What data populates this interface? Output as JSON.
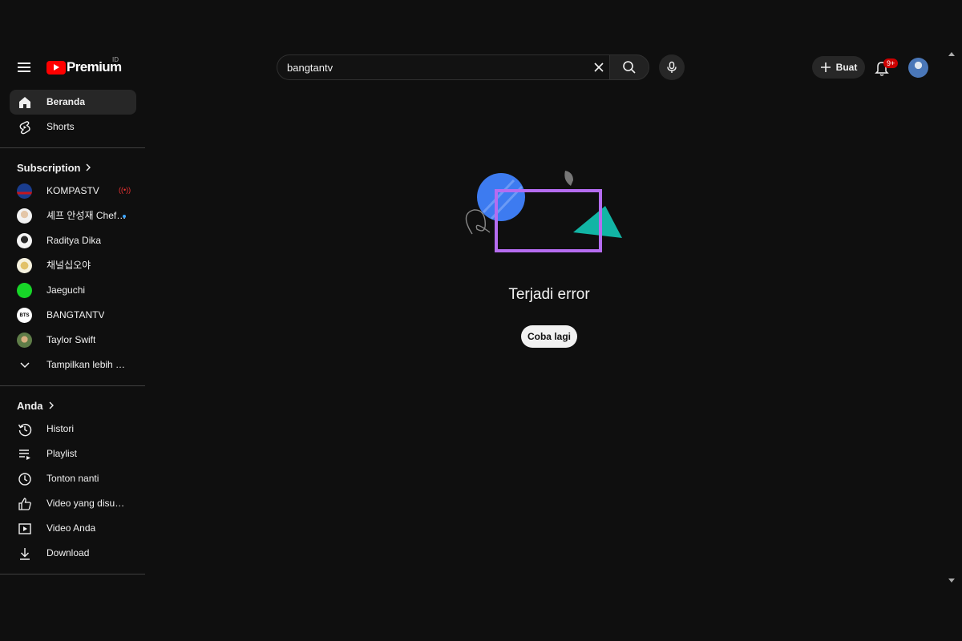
{
  "header": {
    "logo_text": "Premium",
    "country_code": "ID",
    "search": {
      "value": "bangtantv",
      "placeholder": ""
    },
    "create_label": "Buat",
    "notification_count": "9+"
  },
  "sidebar": {
    "main": [
      {
        "label": "Beranda",
        "icon": "home-icon",
        "active": true
      },
      {
        "label": "Shorts",
        "icon": "shorts-icon",
        "active": false
      }
    ],
    "subscription_title": "Subscription",
    "subscriptions": [
      {
        "label": "KOMPASTV",
        "status": "live"
      },
      {
        "label": "셰프 안성재 Chef…",
        "status": "new"
      },
      {
        "label": "Raditya Dika",
        "status": ""
      },
      {
        "label": "채널십오야",
        "status": ""
      },
      {
        "label": "Jaeguchi",
        "status": ""
      },
      {
        "label": "BANGTANTV",
        "status": "",
        "avatar_text": "BTS"
      },
      {
        "label": "Taylor Swift",
        "status": ""
      }
    ],
    "show_more_label": "Tampilkan lebih ba…",
    "you_title": "Anda",
    "you_items": [
      {
        "label": "Histori",
        "icon": "history-icon"
      },
      {
        "label": "Playlist",
        "icon": "playlist-icon"
      },
      {
        "label": "Tonton nanti",
        "icon": "clock-icon"
      },
      {
        "label": "Video yang disukai",
        "icon": "thumbs-up-icon"
      },
      {
        "label": "Video Anda",
        "icon": "video-icon"
      },
      {
        "label": "Download",
        "icon": "download-icon"
      }
    ]
  },
  "main": {
    "error_message": "Terjadi error",
    "retry_label": "Coba lagi"
  },
  "colors": {
    "background": "#0f0f0f",
    "brand_red": "#ff0000",
    "accent_blue": "#3ea6ff",
    "illustration_purple": "#b56cf0",
    "illustration_blue": "#3d7bf0",
    "illustration_teal": "#12b5a5"
  }
}
